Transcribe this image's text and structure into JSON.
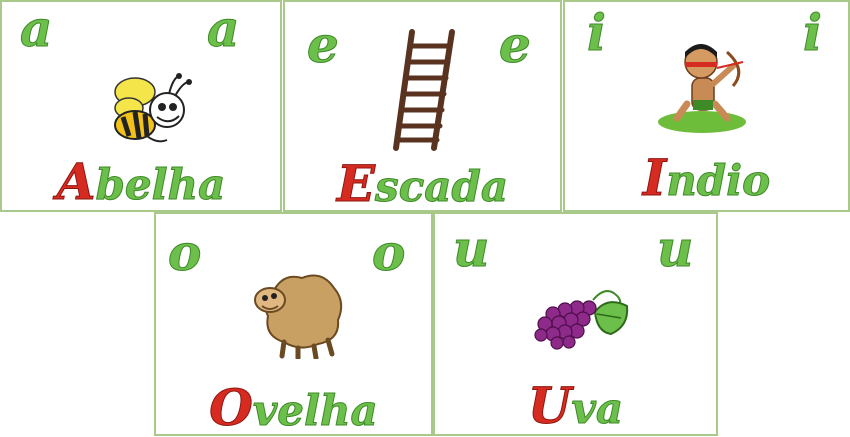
{
  "cards": [
    {
      "letter": "a",
      "initial": "A",
      "rest": "belha",
      "picture": "bee-icon"
    },
    {
      "letter": "e",
      "initial": "E",
      "rest": "scada",
      "picture": "ladder-icon"
    },
    {
      "letter": "i",
      "initial": "I",
      "rest": "ndio",
      "picture": "archer-boy-icon"
    },
    {
      "letter": "o",
      "initial": "O",
      "rest": "velha",
      "picture": "sheep-icon"
    },
    {
      "letter": "u",
      "initial": "U",
      "rest": "va",
      "picture": "grapes-icon"
    }
  ],
  "colors": {
    "letter_green": "#6cbf4a",
    "initial_red": "#d62b20",
    "border": "#a9c98a"
  }
}
